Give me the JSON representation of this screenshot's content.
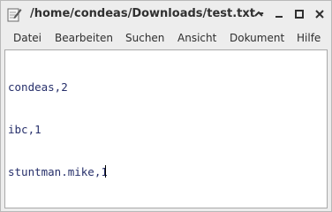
{
  "window": {
    "title": "/home/condeas/Downloads/test.txt -",
    "app_icon": "text-editor-icon",
    "controls": {
      "minimize": "minimize-icon",
      "shade": "shade-icon",
      "maximize": "maximize-icon",
      "close": "close-icon"
    }
  },
  "menubar": {
    "items": [
      "Datei",
      "Bearbeiten",
      "Suchen",
      "Ansicht",
      "Dokument",
      "Hilfe"
    ]
  },
  "editor": {
    "lines": [
      "condeas,2",
      "ibc,1",
      "stuntman.mike,1"
    ],
    "caret_line": 3,
    "text_color": "#27306b"
  }
}
